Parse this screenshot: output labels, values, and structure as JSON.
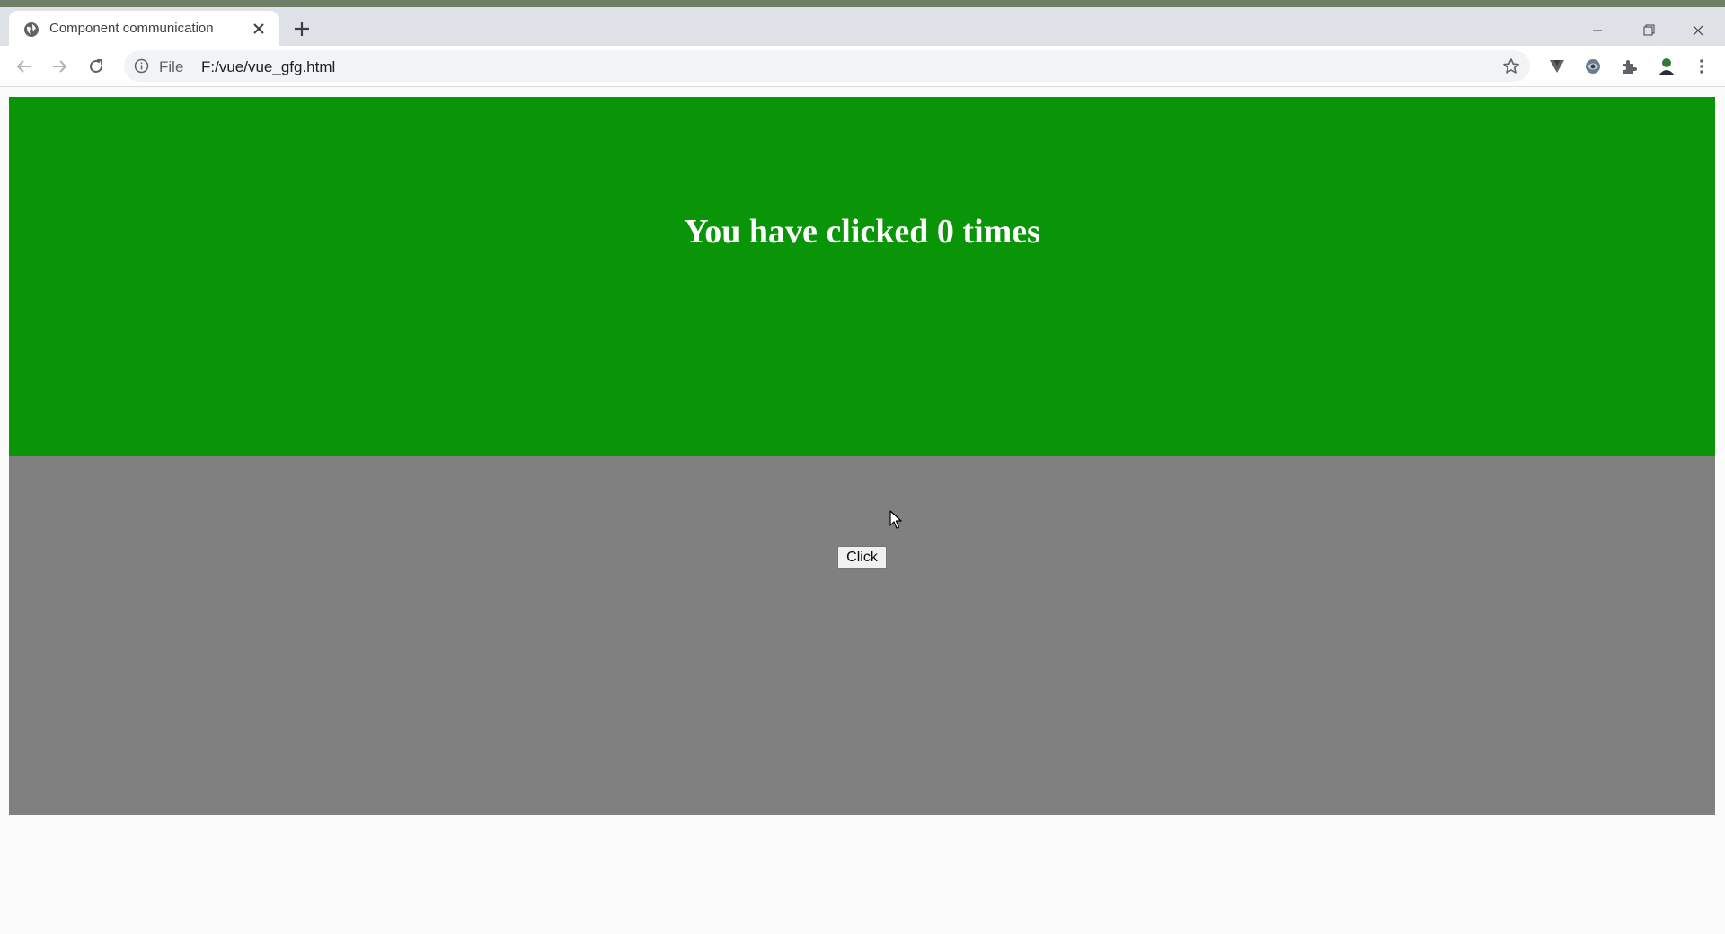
{
  "browser": {
    "tab": {
      "title": "Component communication",
      "favicon": "globe-icon",
      "close": "close-icon"
    },
    "new_tab": "plus-icon",
    "window_controls": [
      "minimize-icon",
      "restore-icon",
      "close-icon"
    ],
    "nav": {
      "back": "back-arrow-icon",
      "forward": "forward-arrow-icon",
      "reload": "reload-icon"
    },
    "address": {
      "info_icon": "info-icon",
      "scheme": "File",
      "path": "F:/vue/vue_gfg.html",
      "bookmark": "star-icon"
    },
    "extensions": [
      "v-extension-icon",
      "tracker-extension-icon",
      "puzzle-icon",
      "profile-avatar-icon",
      "menu-dots-icon"
    ],
    "colors": {
      "tabbar": "#dee1e6",
      "toolbar": "#ffffff",
      "omnibox": "#f1f3f4"
    }
  },
  "page": {
    "counter_text": "You have clicked 0 times",
    "button_label": "Click",
    "colors": {
      "top_panel": "#0a9408",
      "bottom_panel": "#808080",
      "counter_text": "#ffffff"
    }
  }
}
